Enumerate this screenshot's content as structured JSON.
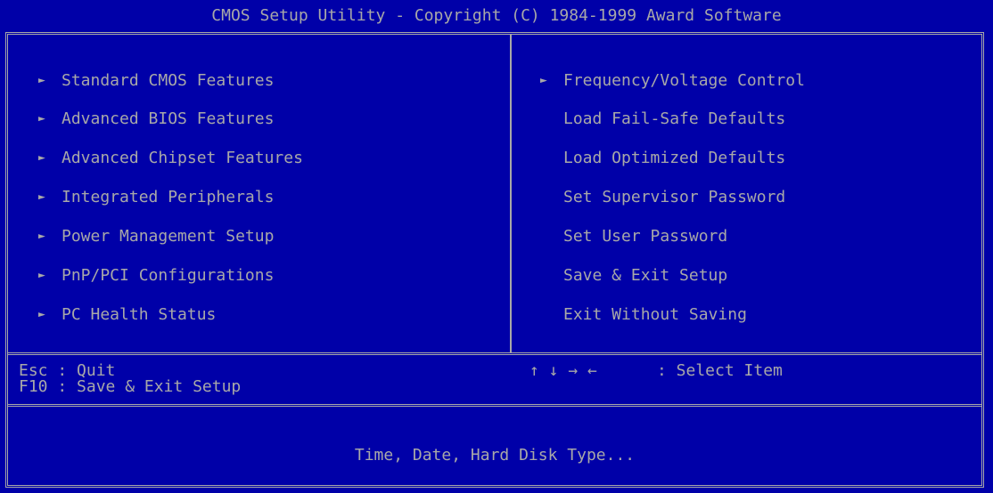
{
  "header": {
    "title": "CMOS Setup Utility - Copyright (C) 1984-1999 Award Software"
  },
  "menu": {
    "left": [
      {
        "label": "Standard CMOS Features",
        "arrow": "►"
      },
      {
        "label": "Advanced BIOS Features",
        "arrow": "►"
      },
      {
        "label": "Advanced Chipset Features",
        "arrow": "►"
      },
      {
        "label": "Integrated Peripherals",
        "arrow": "►"
      },
      {
        "label": "Power Management Setup",
        "arrow": "►"
      },
      {
        "label": "PnP/PCI Configurations",
        "arrow": "►"
      },
      {
        "label": "PC Health Status",
        "arrow": "►"
      }
    ],
    "right": [
      {
        "label": "Frequency/Voltage Control",
        "arrow": "►"
      },
      {
        "label": "Load Fail-Safe Defaults"
      },
      {
        "label": "Load Optimized Defaults"
      },
      {
        "label": "Set Supervisor Password"
      },
      {
        "label": "Set User Password"
      },
      {
        "label": "Save & Exit Setup"
      },
      {
        "label": "Exit Without Saving"
      }
    ]
  },
  "help": {
    "esc": "Esc : Quit",
    "f10": "F10 : Save & Exit Setup",
    "nav_keys": "↑ ↓ → ←",
    "nav_label": ": Select Item"
  },
  "status": {
    "description": "Time, Date, Hard Disk Type..."
  },
  "colors": {
    "background": "#0000a8",
    "text": "#a8a8a8"
  }
}
